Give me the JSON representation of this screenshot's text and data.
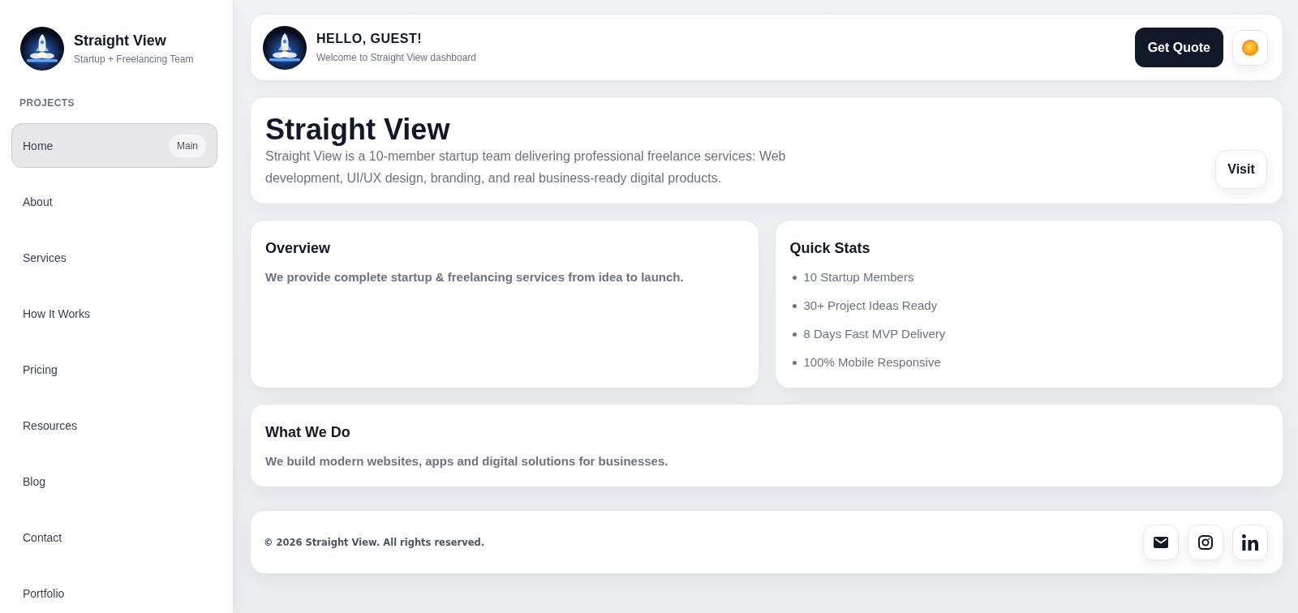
{
  "sidebar": {
    "brand": {
      "title": "Straight View",
      "subtitle": "Startup + Freelancing Team"
    },
    "section_label": "PROJECTS",
    "items": [
      {
        "label": "Home",
        "badge": "Main",
        "selected": true
      },
      {
        "label": "About",
        "selected": false
      },
      {
        "label": "Services",
        "selected": false
      },
      {
        "label": "How It Works",
        "selected": false
      },
      {
        "label": "Pricing",
        "selected": false
      },
      {
        "label": "Resources",
        "selected": false
      },
      {
        "label": "Blog",
        "selected": false
      },
      {
        "label": "Contact",
        "selected": false
      },
      {
        "label": "Portfolio",
        "selected": false
      }
    ]
  },
  "header": {
    "greeting": "HELLO, GUEST!",
    "subtitle": "Welcome to Straight View dashboard",
    "cta_button": "Get Quote"
  },
  "hero": {
    "title": "Straight View",
    "description": "Straight View is a 10-member startup team delivering professional freelance services: Web development, UI/UX design, branding, and real business-ready digital products.",
    "button": "Visit"
  },
  "cards": [
    {
      "kind": "text",
      "title": "Overview",
      "text": "We provide complete startup & freelancing services from idea to launch."
    },
    {
      "kind": "list",
      "title": "Quick Stats",
      "items": [
        "10 Startup Members",
        "30+ Project Ideas Ready",
        "8 Days Fast MVP Delivery",
        "100% Mobile Responsive"
      ]
    }
  ],
  "what_we_do": {
    "title": "What We Do",
    "text": "We build modern websites, apps and digital solutions for businesses."
  },
  "footer": {
    "copyright": "© 2026 Straight View. All rights reserved."
  }
}
